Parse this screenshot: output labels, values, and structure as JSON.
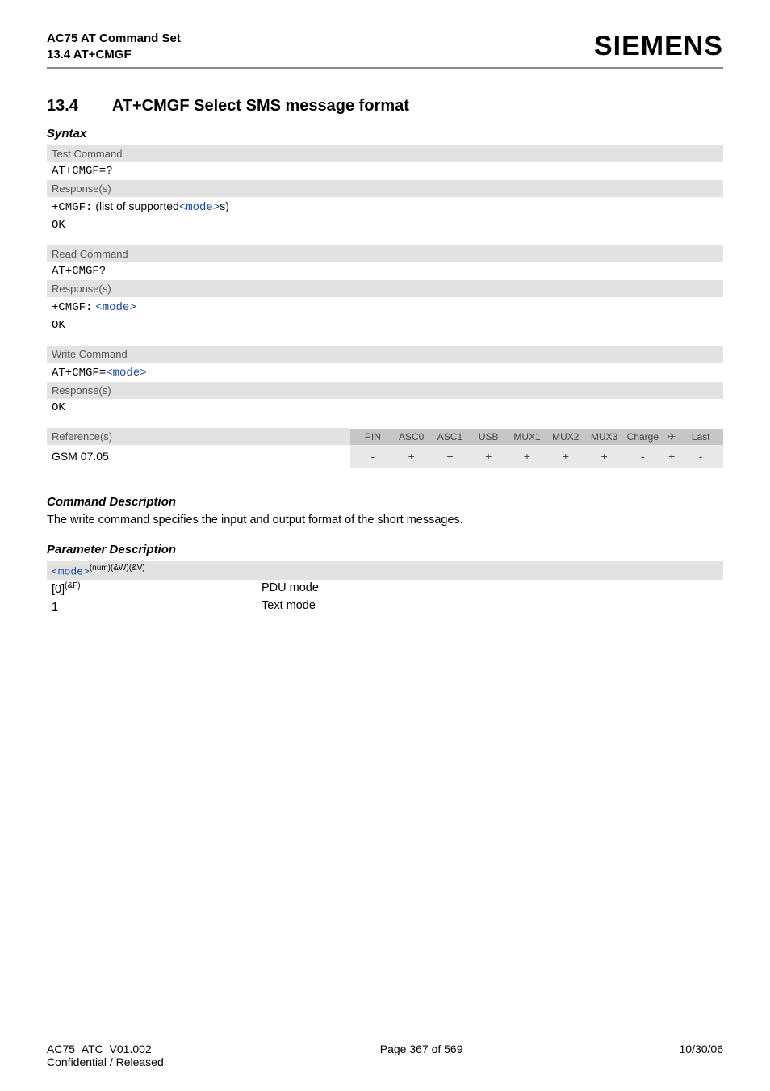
{
  "header": {
    "doc_title": "AC75 AT Command Set",
    "doc_sub": "13.4 AT+CMGF",
    "brand": "SIEMENS"
  },
  "section": {
    "number": "13.4",
    "title": "AT+CMGF   Select SMS message format"
  },
  "syntax": {
    "label": "Syntax",
    "test_label": "Test Command",
    "test_cmd": "AT+CMGF=?",
    "resp_label": "Response(s)",
    "test_resp_prefix": "+CMGF:",
    "test_resp_text1": "(list of supported",
    "test_resp_mode": "<mode>",
    "test_resp_text2": "s)",
    "ok": "OK",
    "read_label": "Read Command",
    "read_cmd": "AT+CMGF?",
    "read_resp_prefix": "+CMGF:",
    "read_resp_mode": "<mode>",
    "write_label": "Write Command",
    "write_cmd_prefix": "AT+CMGF=",
    "write_cmd_mode": "<mode>",
    "ref_label": "Reference(s)",
    "ref_value": "GSM 07.05",
    "cols": [
      "PIN",
      "ASC0",
      "ASC1",
      "USB",
      "MUX1",
      "MUX2",
      "MUX3",
      "Charge",
      "✈",
      "Last"
    ],
    "vals": [
      "-",
      "+",
      "+",
      "+",
      "+",
      "+",
      "+",
      "-",
      "+",
      "-"
    ]
  },
  "cmd_desc": {
    "label": "Command Description",
    "text": "The write command specifies the input and output format of the short messages."
  },
  "param_desc": {
    "label": "Parameter Description",
    "name": "<mode>",
    "sup": "(num)(&W)(&V)",
    "rows": [
      {
        "k": "[0]",
        "ks": "(&F)",
        "v": "PDU mode"
      },
      {
        "k": "1",
        "ks": "",
        "v": "Text mode"
      }
    ]
  },
  "footer": {
    "left1": "AC75_ATC_V01.002",
    "left2": "Confidential / Released",
    "center": "Page 367 of 569",
    "right": "10/30/06"
  }
}
